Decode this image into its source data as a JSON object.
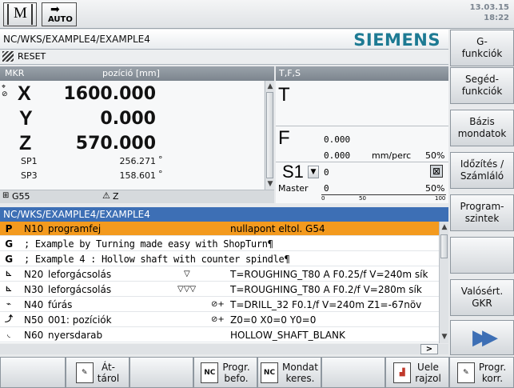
{
  "header": {
    "mode_m": "M",
    "mode_auto": "AUTO",
    "date": "13.03.15",
    "time": "18:22"
  },
  "path": "NC/WKS/EXAMPLE4/EXAMPLE4",
  "brand": "SIEMENS",
  "channel_state": "RESET",
  "axes": {
    "title_left": "MKR",
    "title_unit": "pozíció [mm]",
    "items": [
      {
        "name": "X",
        "value": "1600.000"
      },
      {
        "name": "Y",
        "value": "0.000"
      },
      {
        "name": "Z",
        "value": "570.000"
      }
    ],
    "spindles": [
      {
        "name": "SP1",
        "value": "256.271",
        "unit": "°"
      },
      {
        "name": "SP3",
        "value": "158.601",
        "unit": "°"
      }
    ],
    "work_offset": "G55",
    "status": "Z"
  },
  "tfs": {
    "title": "T,F,S",
    "t_label": "T",
    "f_label": "F",
    "f_value": "0.000",
    "f_actual": "0.000",
    "f_unit": "mm/perc",
    "f_override": "50%",
    "s_label": "S1",
    "s_value": "0",
    "master_label": "Master",
    "master_value": "0",
    "master_override": "50%",
    "bar_tick_0": "0",
    "bar_tick_50": "50",
    "bar_tick_100": "100"
  },
  "program": {
    "title": "NC/WKS/EXAMPLE4/EXAMPLE4",
    "rows": [
      {
        "icon": "P",
        "block": "N10",
        "text": "programfej",
        "right": "nullapont eltol. G54"
      },
      {
        "icon": "G",
        "line": "; Example by Turning made easy with ShopTurn¶"
      },
      {
        "icon": "G",
        "line": "; Example 4 : Hollow shaft with counter spindle¶"
      },
      {
        "block": "N20",
        "text": "leforgácsolás",
        "mark": "▽",
        "right": "T=ROUGHING_T80 A F0.25/f V=240m sík"
      },
      {
        "block": "N30",
        "text": "leforgácsolás",
        "mark": "▽▽▽",
        "right": "T=ROUGHING_T80 A F0.2/f V=280m sík"
      },
      {
        "block": "N40",
        "text": "fúrás",
        "mark": "⊘+",
        "right": "T=DRILL_32 F0.1/f V=240m Z1=-67növ"
      },
      {
        "block": "N50",
        "text": "001: pozíciók",
        "mark": "⊘+",
        "right": "Z0=0 X0=0 Y0=0"
      },
      {
        "block": "N60",
        "text": "nyersdarab",
        "right": "HOLLOW_SHAFT_BLANK"
      }
    ]
  },
  "vertical_softkeys": [
    "G-\nfunkciók",
    "Segéd-\nfunkciók",
    "Bázis\nmondatok",
    "Időzítés /\nSzámláló",
    "Program-\nszintek",
    "",
    "Valósért.\nGKR",
    ""
  ],
  "horizontal_softkeys": {
    "k2": "Át-\ntárol",
    "k4": "Progr.\nbefo.",
    "k5": "Mondat\nkeres.",
    "k7": "Uele\nrajzol",
    "k8": "Progr.\nkorr."
  },
  "colors": {
    "accent_blue": "#3d6fb5",
    "selection_orange": "#f39a1e",
    "brand_teal": "#1d7a93"
  }
}
